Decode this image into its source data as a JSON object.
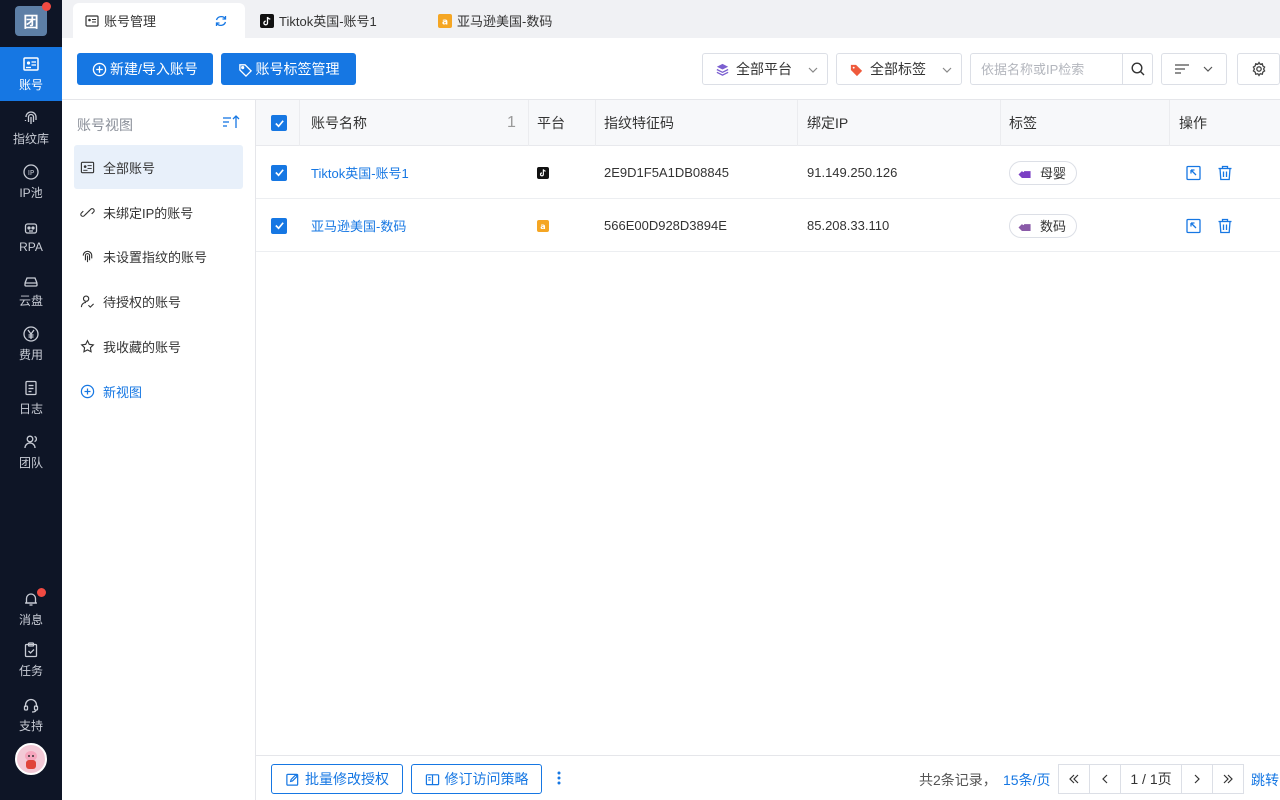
{
  "nav": {
    "logo_text": "团",
    "items": [
      {
        "label": "账号",
        "icon": "account-card-icon"
      },
      {
        "label": "指纹库",
        "icon": "fingerprint-icon"
      },
      {
        "label": "IP池",
        "icon": "ip-icon"
      },
      {
        "label": "RPA",
        "icon": "robot-icon"
      },
      {
        "label": "云盘",
        "icon": "cloud-drive-icon"
      },
      {
        "label": "费用",
        "icon": "yen-icon"
      },
      {
        "label": "日志",
        "icon": "log-icon"
      },
      {
        "label": "团队",
        "icon": "team-icon"
      }
    ],
    "bottom": [
      {
        "label": "消息",
        "icon": "bell-icon"
      },
      {
        "label": "任务",
        "icon": "task-icon"
      },
      {
        "label": "支持",
        "icon": "headset-icon"
      }
    ]
  },
  "tabs": [
    {
      "label": "账号管理",
      "icon": "account-card-icon"
    },
    {
      "label": "Tiktok英国-账号1",
      "icon": "tiktok-icon"
    },
    {
      "label": "亚马逊美国-数码",
      "icon": "amazon-icon"
    }
  ],
  "toolbar": {
    "new_import": "新建/导入账号",
    "tag_manage": "账号标签管理",
    "platform_select": "全部平台",
    "tag_select": "全部标签",
    "search_placeholder": "依据名称或IP检索"
  },
  "views": {
    "title": "账号视图",
    "items": [
      {
        "label": "全部账号"
      },
      {
        "label": "未绑定IP的账号"
      },
      {
        "label": "未设置指纹的账号"
      },
      {
        "label": "待授权的账号"
      },
      {
        "label": "我收藏的账号"
      }
    ],
    "new_view": "新视图"
  },
  "table": {
    "columns": {
      "name": "账号名称",
      "name_count": "1",
      "platform": "平台",
      "fingerprint": "指纹特征码",
      "ip": "绑定IP",
      "tag": "标签",
      "ops": "操作"
    },
    "rows": [
      {
        "name": "Tiktok英国-账号1",
        "platform": "tiktok",
        "fingerprint": "2E9D1F5A1DB08845",
        "ip": "91.149.250.126",
        "tag": "母婴",
        "tag_color": "#7b3fc4"
      },
      {
        "name": "亚马逊美国-数码",
        "platform": "amazon",
        "fingerprint": "566E00D928D3894E",
        "ip": "85.208.33.110",
        "tag": "数码",
        "tag_color": "#8a5aa8"
      }
    ]
  },
  "footer": {
    "batch_auth": "批量修改授权",
    "revise_policy": "修订访问策略",
    "total": "共2条记录，",
    "per_page": "15条/页",
    "page": "1 / 1页",
    "jump": "跳转"
  },
  "colors": {
    "primary": "#1677e3",
    "nav_bg": "#0e1526",
    "alert": "#f04a42"
  }
}
